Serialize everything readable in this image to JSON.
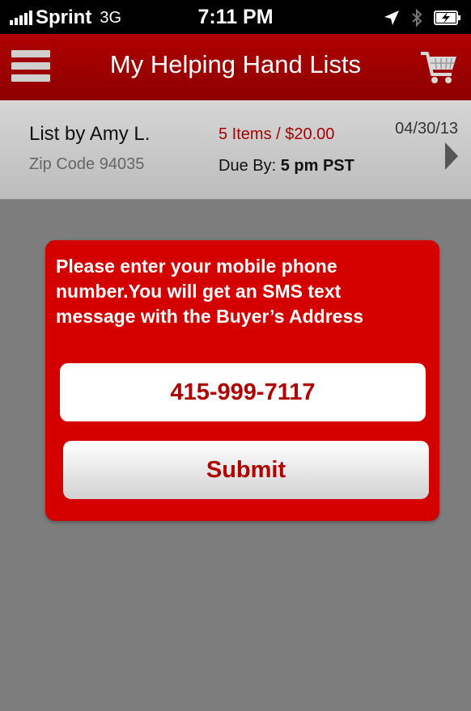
{
  "status_bar": {
    "carrier": "Sprint",
    "network": "3G",
    "time": "7:11 PM",
    "icons": [
      "signal-bars-icon",
      "location-arrow-icon",
      "bluetooth-icon",
      "battery-charging-icon"
    ]
  },
  "header": {
    "title": "My Helping Hand Lists",
    "menu_icon": "hamburger-menu-icon",
    "cart_icon": "shopping-cart-icon",
    "background_color": "#a00000"
  },
  "list_card": {
    "owner": "List by  Amy L.",
    "zip": "Zip Code 94035",
    "items_summary": "5 Items / $20.00",
    "due_label": "Due By: ",
    "due_value": "5 pm PST",
    "date": "04/30/13",
    "chevron_icon": "chevron-right-icon"
  },
  "modal": {
    "message": "Please enter your mobile phone\nnumber.You will get an SMS text\nmessage with the Buyer’s Address",
    "phone_value": "415-999-7117",
    "submit_label": "Submit",
    "accent_color": "#d40000"
  }
}
